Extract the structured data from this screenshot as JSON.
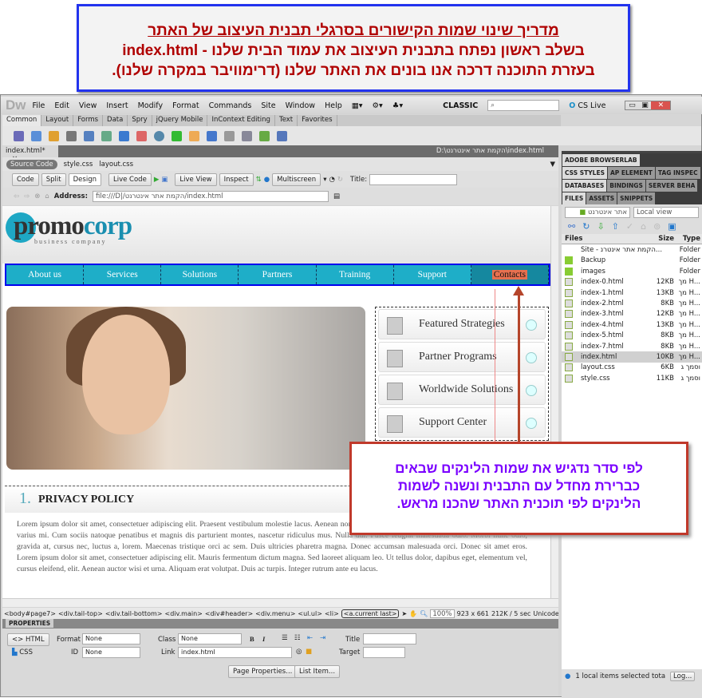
{
  "callout_top": {
    "title": "מדריך שינוי שמות הקישורים בסרגלי תבנית העיצוב של האתר",
    "line2": "בשלב ראשון נפתח בתבנית העיצוב את עמוד הבית שלנו - index.html",
    "line3": "בעזרת התוכנה דרכה אנו בונים את האתר שלנו (דרימוויבר במקרה שלנו)."
  },
  "app": {
    "logo": "Dw",
    "menu": [
      "File",
      "Edit",
      "View",
      "Insert",
      "Modify",
      "Format",
      "Commands",
      "Site",
      "Window",
      "Help"
    ],
    "workspace": "CLASSIC",
    "cs_live": "CS Live"
  },
  "insert_tabs": [
    "Common",
    "Layout",
    "Forms",
    "Data",
    "Spry",
    "jQuery Mobile",
    "InContext Editing",
    "Text",
    "Favorites"
  ],
  "document": {
    "tab": "index.html*",
    "path": "D:\\הקמת אתר אינטרנט\\index.html",
    "related": [
      "Source Code",
      "style.css",
      "layout.css"
    ],
    "views": [
      "Code",
      "Split",
      "Design"
    ],
    "live_code": "Live Code",
    "live_view": "Live View",
    "inspect": "Inspect",
    "multiscreen": "Multiscreen",
    "title_label": "Title:",
    "title_value": "",
    "address_label": "Address:",
    "address": "file:///D|/הקמת אתר אינטרנט/index.html"
  },
  "site": {
    "logo_a": "promo",
    "logo_b": "corp",
    "tagline": "business company",
    "menu": [
      "About us",
      "Services",
      "Solutions",
      "Partners",
      "Training",
      "Support",
      "Contacts"
    ],
    "side": [
      "Featured Strategies",
      "Partner Programs",
      "Worldwide Solutions",
      "Support Center"
    ],
    "section_num": "1.",
    "section_title": "PRIVACY POLICY",
    "lorem": "Lorem ipsum dolor sit amet, consectetuer adipiscing elit. Praesent vestibulum molestie lacus. Aenean nonummy hendrerit mauris. Phasellus porta. Fusce suscipit varius mi. Cum sociis natoque penatibus et magnis dis parturient montes, nascetur ridiculus mus. Nulla dui. Fusce feugiat malesuada odio. Morbi nunc odio, gravida at, cursus nec, luctus a, lorem. Maecenas tristique orci ac sem. Duis ultricies pharetra magna. Donec accumsan malesuada orci. Donec sit amet eros. Lorem ipsum dolor sit amet, consectetuer adipiscing elit. Mauris fermentum dictum magna. Sed laoreet aliquam leo. Ut tellus dolor, dapibus eget, elementum vel, cursus eleifend, elit. Aenean auctor wisi et urna. Aliquam erat volutpat. Duis ac turpis. Integer rutrum ante eu lacus."
  },
  "callout2": {
    "l1": "לפי סדר נדגיש את שמות הלינקים שבאים",
    "l2": "כברירת מחדל עם התבנית ונשנה לשמות",
    "l3": "הלינקים לפי תוכנית האתר שהכנו מראש."
  },
  "tag_selector": [
    "<body#page7>",
    "<div.tail-top>",
    "<div.tail-bottom>",
    "<div.main>",
    "<div#header>",
    "<div.menu>",
    "<ul.ul>",
    "<li>",
    "<a.current last>"
  ],
  "status": {
    "zoom": "100%",
    "size": "923 x 661",
    "download": "212K / 5 sec",
    "encoding": "Unicode (UTF-8"
  },
  "properties": {
    "title": "PROPERTIES",
    "html": "HTML",
    "css": "CSS",
    "format_label": "Format",
    "format": "None",
    "id_label": "ID",
    "id": "None",
    "class_label": "Class",
    "class": "None",
    "link_label": "Link",
    "link": "index.html",
    "title_label": "Title",
    "target_label": "Target",
    "page_props": "Page Properties...",
    "list_item": "List Item..."
  },
  "panels": {
    "browserlab": "ADOBE BROWSERLAB",
    "css_tabs": [
      "CSS STYLES",
      "AP ELEMENT",
      "TAG INSPEC"
    ],
    "db_tabs": [
      "DATABASES",
      "BINDINGS",
      "SERVER BEHA"
    ],
    "file_tabs": [
      "FILES",
      "ASSETS",
      "SNIPPETS"
    ],
    "site_select": "אתר אינטרנט",
    "view_select": "Local view",
    "cols": [
      "Files",
      "Size",
      "Type"
    ],
    "files": [
      {
        "name": "Site - הקמת אתר אינטרנ...",
        "size": "",
        "type": "Folder",
        "kind": "site"
      },
      {
        "name": "Backup",
        "size": "",
        "type": "Folder",
        "kind": "folder"
      },
      {
        "name": "images",
        "size": "",
        "type": "Folder",
        "kind": "folder"
      },
      {
        "name": "index-0.html",
        "size": "12KB",
        "type": "מך H...",
        "kind": "file"
      },
      {
        "name": "index-1.html",
        "size": "13KB",
        "type": "מך H...",
        "kind": "file"
      },
      {
        "name": "index-2.html",
        "size": "8KB",
        "type": "מך H...",
        "kind": "file"
      },
      {
        "name": "index-3.html",
        "size": "12KB",
        "type": "מך H...",
        "kind": "file"
      },
      {
        "name": "index-4.html",
        "size": "13KB",
        "type": "מך H...",
        "kind": "file"
      },
      {
        "name": "index-5.html",
        "size": "8KB",
        "type": "מך H...",
        "kind": "file"
      },
      {
        "name": "index-7.html",
        "size": "8KB",
        "type": "מך H...",
        "kind": "file"
      },
      {
        "name": "index.html",
        "size": "10KB",
        "type": "מך H...",
        "kind": "file",
        "selected": true
      },
      {
        "name": "layout.css",
        "size": "6KB",
        "type": "וסמך ג",
        "kind": "file"
      },
      {
        "name": "style.css",
        "size": "11KB",
        "type": "וסמך ג",
        "kind": "file"
      }
    ],
    "status": "1 local items selected tota",
    "log": "Log..."
  }
}
